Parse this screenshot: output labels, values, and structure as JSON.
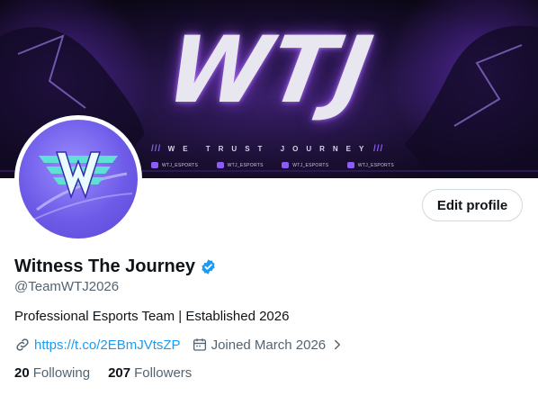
{
  "banner": {
    "logo_text": "WTJ",
    "tagline": "WE TRUST JOURNEY",
    "deco_left": "///",
    "deco_right": "///",
    "socials": [
      {
        "icon": "x-icon",
        "label": "WTJ_ESPORTS"
      },
      {
        "icon": "instagram-icon",
        "label": "WTJ_ESPORTS"
      },
      {
        "icon": "youtube-icon",
        "label": "WTJ_ESPORTS"
      },
      {
        "icon": "discord-icon",
        "label": "WTJ_ESPORTS"
      }
    ]
  },
  "profile": {
    "display_name": "Witness The Journey",
    "verified": true,
    "handle": "@TeamWTJ2026",
    "bio": "Professional Esports Team | Established 2026",
    "link": "https://t.co/2EBmJVtsZP",
    "joined": "Joined March 2026",
    "following_count": "20",
    "following_label": "Following",
    "followers_count": "207",
    "followers_label": "Followers"
  },
  "actions": {
    "edit_profile_label": "Edit profile"
  },
  "colors": {
    "accent": "#1d9bf0",
    "text_primary": "#0f1419",
    "text_secondary": "#536471",
    "banner_purple": "#8b5cf6"
  }
}
